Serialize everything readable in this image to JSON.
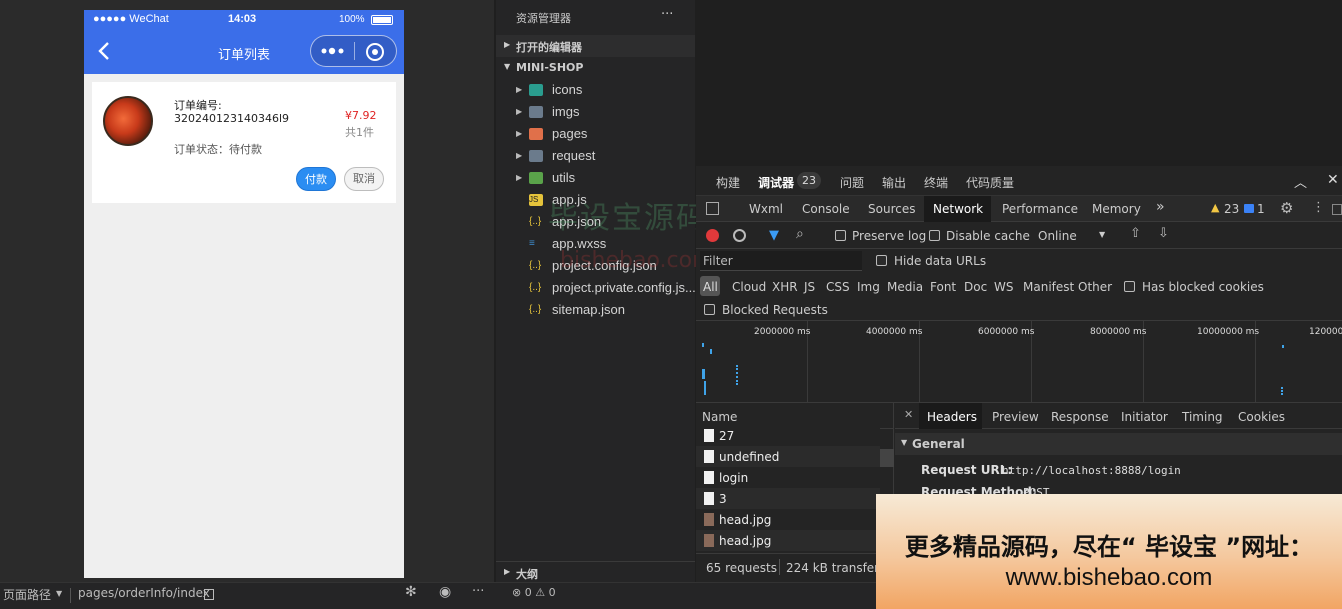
{
  "simulator": {
    "status": {
      "carrier": "●●●●● WeChat",
      "time": "14:03",
      "battery": "100%"
    },
    "nav": {
      "title": "订单列表",
      "back_icon": "chevron-left-icon"
    },
    "order": {
      "number_label": "订单编号:",
      "number_value": "320240123140346l9",
      "price": "¥7.92",
      "count": "共1件",
      "status": "订单状态：待付款",
      "pay_button": "付款",
      "cancel_button": "取消"
    }
  },
  "bottom_bar": {
    "page_path_label": "页面路径",
    "page_path_value": "pages/orderInfo/index",
    "problems": "⊗ 0 ⚠ 0"
  },
  "explorer": {
    "title": "资源管理器",
    "more": "···",
    "open_editors": "打开的编辑器",
    "project": "MINI-SHOP",
    "outline": "大纲",
    "items": [
      {
        "name": "icons",
        "type": "folder",
        "color": "#2a9d8f"
      },
      {
        "name": "imgs",
        "type": "folder",
        "color": "#6b7b8c"
      },
      {
        "name": "pages",
        "type": "folder",
        "color": "#e0704a"
      },
      {
        "name": "request",
        "type": "folder",
        "color": "#6b7b8c"
      },
      {
        "name": "utils",
        "type": "folder",
        "color": "#5aa34a"
      },
      {
        "name": "app.js",
        "type": "js",
        "color": "#e5c33b"
      },
      {
        "name": "app.json",
        "type": "json",
        "color": "#e5c33b"
      },
      {
        "name": "app.wxss",
        "type": "css",
        "color": "#3e8ed0"
      },
      {
        "name": "project.config.json",
        "type": "json",
        "color": "#e5c33b"
      },
      {
        "name": "project.private.config.js...",
        "type": "json",
        "color": "#e5c33b"
      },
      {
        "name": "sitemap.json",
        "type": "json",
        "color": "#e5c33b"
      }
    ]
  },
  "watermark": {
    "cn": "毕设宝源码网",
    "en": "bishebao.com"
  },
  "devtools": {
    "top_tabs": [
      "构建",
      "调试器",
      "问题",
      "输出",
      "终端",
      "代码质量"
    ],
    "debugger_badge": "23",
    "panel_tabs": [
      "Wxml",
      "Console",
      "Sources",
      "Network",
      "Performance",
      "Memory"
    ],
    "warn_count": "23",
    "info_count": "1",
    "preserve_log": "Preserve log",
    "disable_cache": "Disable cache",
    "throttle": "Online",
    "filter_placeholder": "Filter",
    "hide_data_urls": "Hide data URLs",
    "type_filters": [
      "All",
      "Cloud",
      "XHR",
      "JS",
      "CSS",
      "Img",
      "Media",
      "Font",
      "Doc",
      "WS",
      "Manifest",
      "Other"
    ],
    "has_blocked_cookies": "Has blocked cookies",
    "blocked_requests": "Blocked Requests",
    "timeline_ticks": [
      "2000000 ms",
      "4000000 ms",
      "6000000 ms",
      "8000000 ms",
      "10000000 ms",
      "120000"
    ],
    "name_header": "Name",
    "requests": [
      "27",
      "undefined",
      "login",
      "3",
      "head.jpg",
      "head.jpg"
    ],
    "detail_tabs": [
      "Headers",
      "Preview",
      "Response",
      "Initiator",
      "Timing",
      "Cookies"
    ],
    "general_label": "General",
    "request_url_label": "Request URL:",
    "request_url_value": "http://localhost:8888/login",
    "request_method_label": "Request Method:",
    "request_method_value": "POST",
    "summary_requests": "65 requests",
    "summary_transferred": "224 kB transferre"
  },
  "ad": {
    "line1": "更多精品源码，尽在“ 毕设宝 ”网址：",
    "line2": "www.bishebao.com"
  }
}
